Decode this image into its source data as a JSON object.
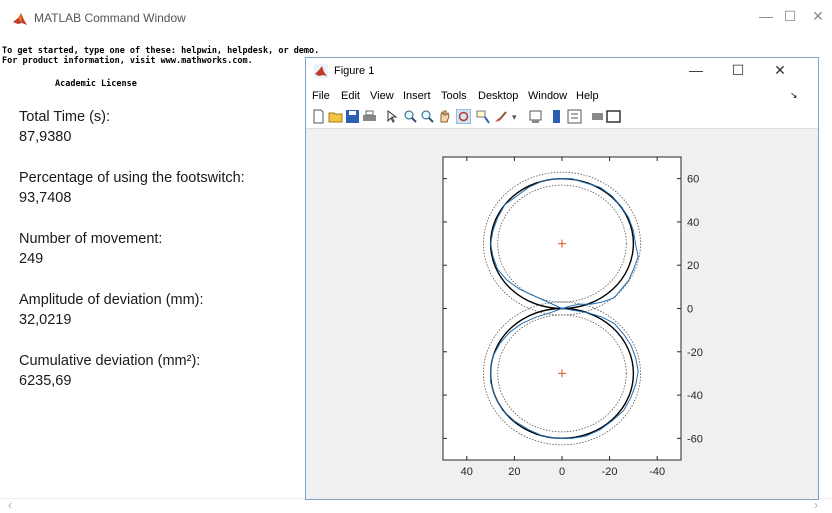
{
  "window": {
    "title": "MATLAB Command Window"
  },
  "console": {
    "line1": "To get started, type one of these: helpwin, helpdesk, or demo.",
    "line2": "For product information, visit www.mathworks.com.",
    "license": "Academic License"
  },
  "stats": [
    {
      "label": "Total Time (s):",
      "value": "87,9380"
    },
    {
      "label": "Percentage of using the footswitch:",
      "value": "93,7408"
    },
    {
      "label": "Number of movement:",
      "value": "249"
    },
    {
      "label": "Amplitude of deviation (mm):",
      "value": "32,0219"
    },
    {
      "label": "Cumulative deviation (mm²):",
      "value": "6235,69"
    }
  ],
  "figure": {
    "title": "Figure 1",
    "menu": [
      "File",
      "Edit",
      "View",
      "Insert",
      "Tools",
      "Desktop",
      "Window",
      "Help"
    ],
    "toolbar_icons": [
      "new-figure-icon",
      "open-file-icon",
      "save-icon",
      "print-icon",
      "pointer-icon",
      "zoom-in-icon",
      "zoom-out-icon",
      "pan-icon",
      "rotate-icon",
      "data-cursor-icon",
      "brush-icon",
      "link-icon",
      "colorbar-icon",
      "legend-icon",
      "hide-plot-tools-icon",
      "show-plot-tools-icon"
    ]
  },
  "chart_data": {
    "type": "line",
    "title": "",
    "xlabel": "",
    "ylabel": "",
    "xlim": [
      50,
      -50
    ],
    "ylim": [
      -70,
      70
    ],
    "x_reversed": true,
    "x_ticks": [
      40,
      20,
      0,
      -20,
      -40
    ],
    "x_tick_labels": [
      "40",
      "20",
      "0",
      "-20",
      "-40"
    ],
    "y_ticks": [
      60,
      40,
      20,
      0,
      -20,
      -40,
      -60
    ],
    "y_tick_labels": [
      "60",
      "40",
      "20",
      "0",
      "-20",
      "-40",
      "-60"
    ],
    "y_axis_side": "right",
    "grid": false,
    "colors": {
      "trace": "#1f6fb4",
      "circle": "#000000",
      "center": "#d95319"
    },
    "reference_circles": [
      {
        "center": [
          0,
          30
        ],
        "radius": 30
      },
      {
        "center": [
          0,
          -30
        ],
        "radius": 30
      }
    ],
    "tolerance_circles": [
      {
        "center": [
          0,
          30
        ],
        "radius": 33
      },
      {
        "center": [
          0,
          30
        ],
        "radius": 27
      },
      {
        "center": [
          0,
          -30
        ],
        "radius": 33
      },
      {
        "center": [
          0,
          -30
        ],
        "radius": 27
      }
    ],
    "center_markers": [
      [
        0,
        30
      ],
      [
        0,
        -30
      ]
    ],
    "trace_points": [
      [
        0,
        0
      ],
      [
        6,
        3
      ],
      [
        12,
        6
      ],
      [
        18,
        9
      ],
      [
        23,
        13
      ],
      [
        27,
        18
      ],
      [
        29,
        24
      ],
      [
        30,
        30
      ],
      [
        29,
        36
      ],
      [
        27,
        42
      ],
      [
        24,
        48
      ],
      [
        19,
        52
      ],
      [
        14,
        56
      ],
      [
        8,
        59
      ],
      [
        2,
        60
      ],
      [
        -4,
        60
      ],
      [
        -10,
        58
      ],
      [
        -16,
        56
      ],
      [
        -21,
        52
      ],
      [
        -25,
        47
      ],
      [
        -28,
        42
      ],
      [
        -30,
        36
      ],
      [
        -31,
        29
      ],
      [
        -32,
        24
      ],
      [
        -30,
        18
      ],
      [
        -28,
        13
      ],
      [
        -25,
        9
      ],
      [
        -22,
        5
      ],
      [
        -17,
        3
      ],
      [
        -12,
        2
      ],
      [
        -7,
        2
      ],
      [
        -3,
        1
      ],
      [
        0,
        0
      ],
      [
        5,
        -2
      ],
      [
        11,
        -4
      ],
      [
        17,
        -7
      ],
      [
        22,
        -11
      ],
      [
        26,
        -16
      ],
      [
        29,
        -22
      ],
      [
        30,
        -28
      ],
      [
        30,
        -34
      ],
      [
        28,
        -41
      ],
      [
        25,
        -47
      ],
      [
        20,
        -52
      ],
      [
        14,
        -56
      ],
      [
        8,
        -59
      ],
      [
        2,
        -60
      ],
      [
        -4,
        -60
      ],
      [
        -10,
        -59
      ],
      [
        -16,
        -56
      ],
      [
        -21,
        -52
      ],
      [
        -26,
        -47
      ],
      [
        -29,
        -41
      ],
      [
        -31,
        -35
      ],
      [
        -32,
        -29
      ],
      [
        -31,
        -23
      ],
      [
        -29,
        -17
      ],
      [
        -26,
        -12
      ],
      [
        -22,
        -7
      ],
      [
        -17,
        -4
      ],
      [
        -11,
        -2
      ],
      [
        -6,
        -1
      ],
      [
        0,
        0
      ]
    ]
  }
}
